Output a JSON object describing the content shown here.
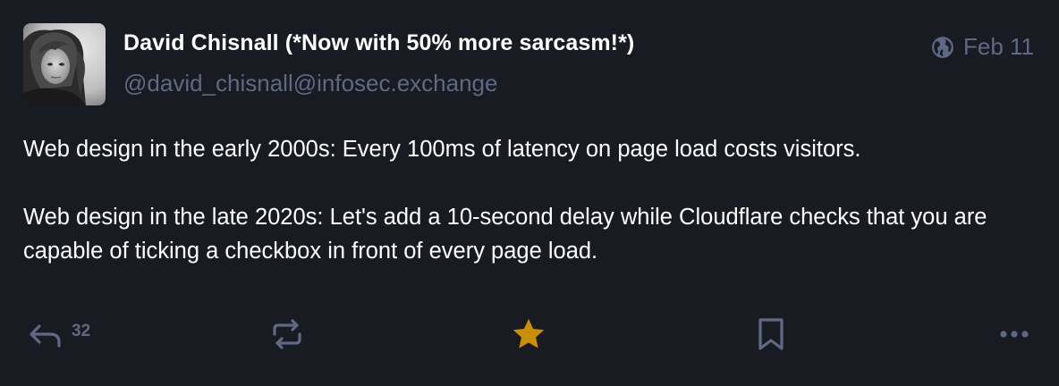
{
  "author": {
    "display_name": "David Chisnall (*Now with 50% more sarcasm!*)",
    "handle": "@david_chisnall@infosec.exchange"
  },
  "meta": {
    "visibility_icon": "globe-icon",
    "date": "Feb 11"
  },
  "content": {
    "paragraph_1": "Web design in the early 2000s: Every 100ms of latency on page load costs visitors.",
    "paragraph_2": "Web design in the late 2020s: Let's add a 10-second delay while Cloudflare checks that you are capable of ticking a checkbox in front of every page load."
  },
  "actions": {
    "reply_count": "32",
    "reply_icon": "reply-icon",
    "boost_icon": "boost-icon",
    "favourite_icon": "star-icon",
    "bookmark_icon": "bookmark-icon",
    "more_icon": "more-icon"
  },
  "colors": {
    "background": "#191b22",
    "muted": "#606984",
    "favourite_active": "#ca8f04",
    "text": "#ffffff"
  }
}
